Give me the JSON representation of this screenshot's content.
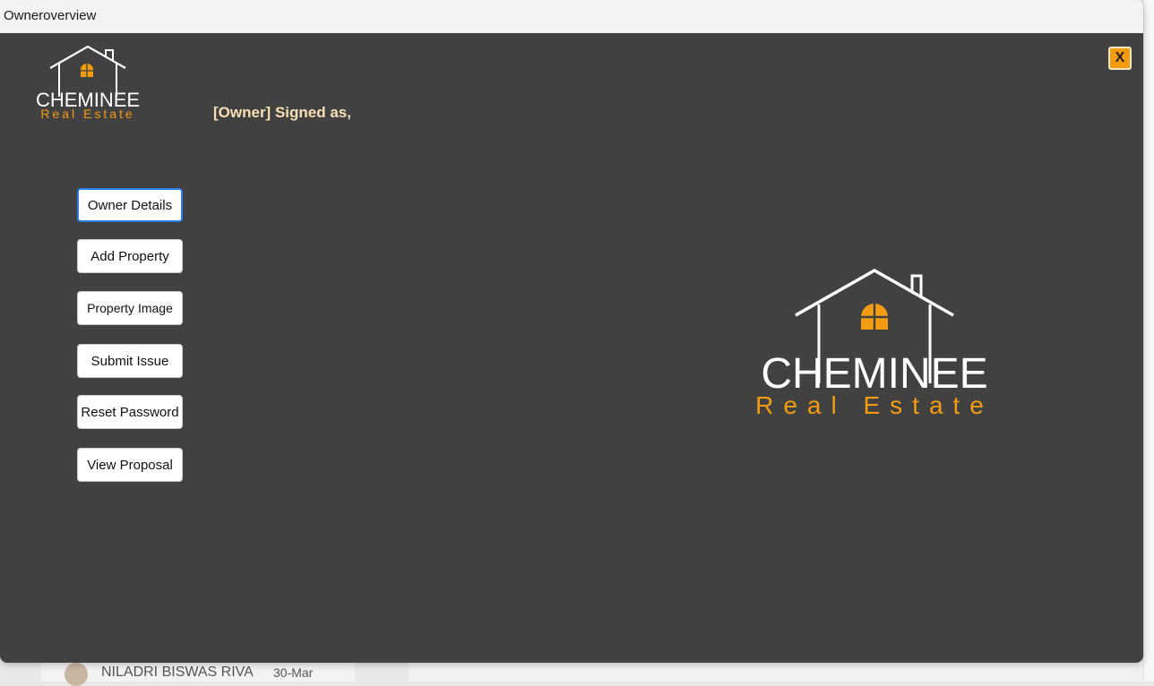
{
  "window": {
    "title": "Owneroverview"
  },
  "header": {
    "signed_text": "[Owner] Signed as,",
    "close_label": "X"
  },
  "logo": {
    "brand": "CHEMINEE",
    "tagline": "Real Estate"
  },
  "menu": {
    "items": [
      {
        "label": "Owner Details",
        "active": true
      },
      {
        "label": "Add Property",
        "active": false
      },
      {
        "label": "Property Image",
        "active": false
      },
      {
        "label": "Submit Issue",
        "active": false
      },
      {
        "label": "Reset Password",
        "active": false
      },
      {
        "label": "View Proposal",
        "active": false
      }
    ]
  },
  "background": {
    "contact_name": "NILADRI BISWAS RIVA",
    "contact_date": "30-Mar"
  },
  "colors": {
    "accent": "#f39c12",
    "panel": "#414141",
    "signed_text": "#f9dfb5"
  }
}
